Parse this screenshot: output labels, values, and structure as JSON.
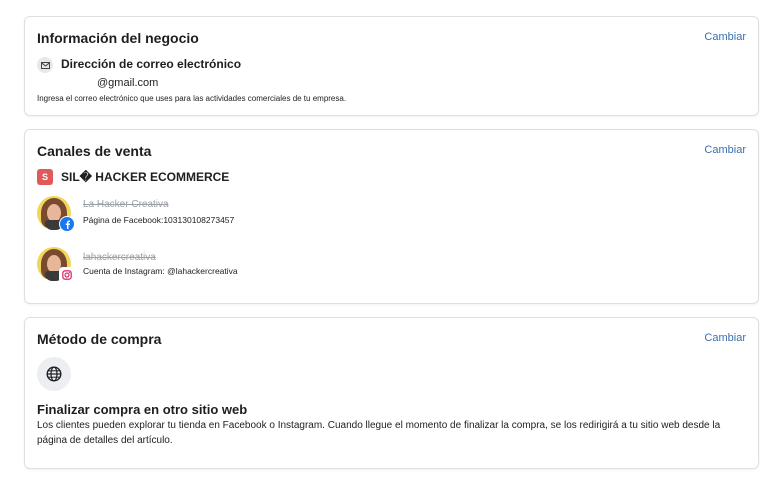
{
  "business_info": {
    "title": "Información del negocio",
    "change_label": "Cambiar",
    "email_label": "Dirección de correo electrónico",
    "email_value": "@gmail.com",
    "email_help": "Ingresa el correo electrónico que uses para las actividades comerciales de tu empresa."
  },
  "sales_channels": {
    "title": "Canales de venta",
    "change_label": "Cambiar",
    "shop_badge": "S",
    "shop_name": "SIL� HACKER ECOMMERCE",
    "accounts": [
      {
        "name": "La Hacker Creativa",
        "meta": "Página de Facebook:103130108273457",
        "network_icon": "facebook-icon"
      },
      {
        "name": "lahackercreativa",
        "meta": "Cuenta de Instagram: @lahackercreativa",
        "network_icon": "instagram-icon"
      }
    ]
  },
  "checkout_method": {
    "title": "Método de compra",
    "change_label": "Cambiar",
    "icon": "globe-icon",
    "option_title": "Finalizar compra en otro sitio web",
    "option_desc": "Los clientes pueden explorar tu tienda en Facebook o Instagram. Cuando llegue el momento de finalizar la compra, se los redirigirá a tu sitio web desde la página de detalles del artículo."
  },
  "colors": {
    "link": "#3b6fb0",
    "facebook": "#1877f2",
    "shop_badge": "#e05a5a"
  }
}
